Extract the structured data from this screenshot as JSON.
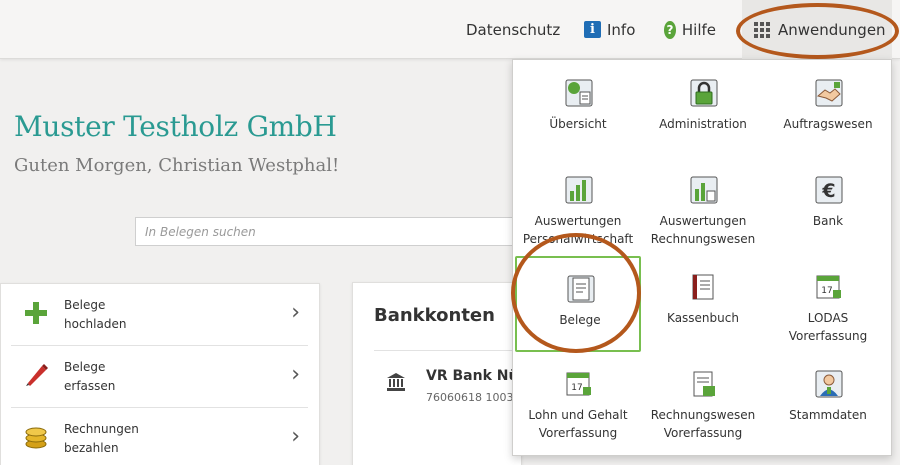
{
  "topbar": {
    "datenschutz": "Datenschutz",
    "info": "Info",
    "hilfe": "Hilfe",
    "anwendungen": "Anwendungen"
  },
  "company": {
    "name": "Muster Testholz GmbH",
    "greeting": "Guten Morgen, Christian Westphal!"
  },
  "search": {
    "placeholder": "In Belegen suchen",
    "value": ""
  },
  "actions": [
    {
      "line1": "Belege",
      "line2": "hochladen",
      "icon": "plus-icon"
    },
    {
      "line1": "Belege",
      "line2": "erfassen",
      "icon": "pencil-icon"
    },
    {
      "line1": "Rechnungen",
      "line2": "bezahlen",
      "icon": "coins-icon"
    }
  ],
  "bank": {
    "title": "Bankkonten",
    "account_name": "VR Bank Nü",
    "account_number": "76060618 1003",
    "icon": "bank-building-icon"
  },
  "apps": [
    {
      "line1": "Übersicht",
      "line2": "",
      "icon": "overview-icon"
    },
    {
      "line1": "Administration",
      "line2": "",
      "icon": "lock-icon"
    },
    {
      "line1": "Auftragswesen",
      "line2": "",
      "icon": "handshake-icon"
    },
    {
      "line1": "Auswertungen",
      "line2": "Personalwirtschaft",
      "icon": "chart-people-icon"
    },
    {
      "line1": "Auswertungen",
      "line2": "Rechnungswesen",
      "icon": "chart-calculator-icon"
    },
    {
      "line1": "Bank",
      "line2": "",
      "icon": "euro-icon"
    },
    {
      "line1": "Belege",
      "line2": "",
      "icon": "document-icon",
      "selected": true
    },
    {
      "line1": "Kassenbuch",
      "line2": "",
      "icon": "cashbook-icon"
    },
    {
      "line1": "LODAS",
      "line2": "Vorerfassung",
      "icon": "calendar-17-icon"
    },
    {
      "line1": "Lohn und Gehalt",
      "line2": "Vorerfassung",
      "icon": "calendar-17-icon"
    },
    {
      "line1": "Rechnungswesen",
      "line2": "Vorerfassung",
      "icon": "ledger-icon"
    },
    {
      "line1": "Stammdaten",
      "line2": "",
      "icon": "person-icon"
    }
  ],
  "colors": {
    "brand_teal": "#2a9a92",
    "selected_border": "#78bf4f",
    "annotation": "#b4581c"
  }
}
